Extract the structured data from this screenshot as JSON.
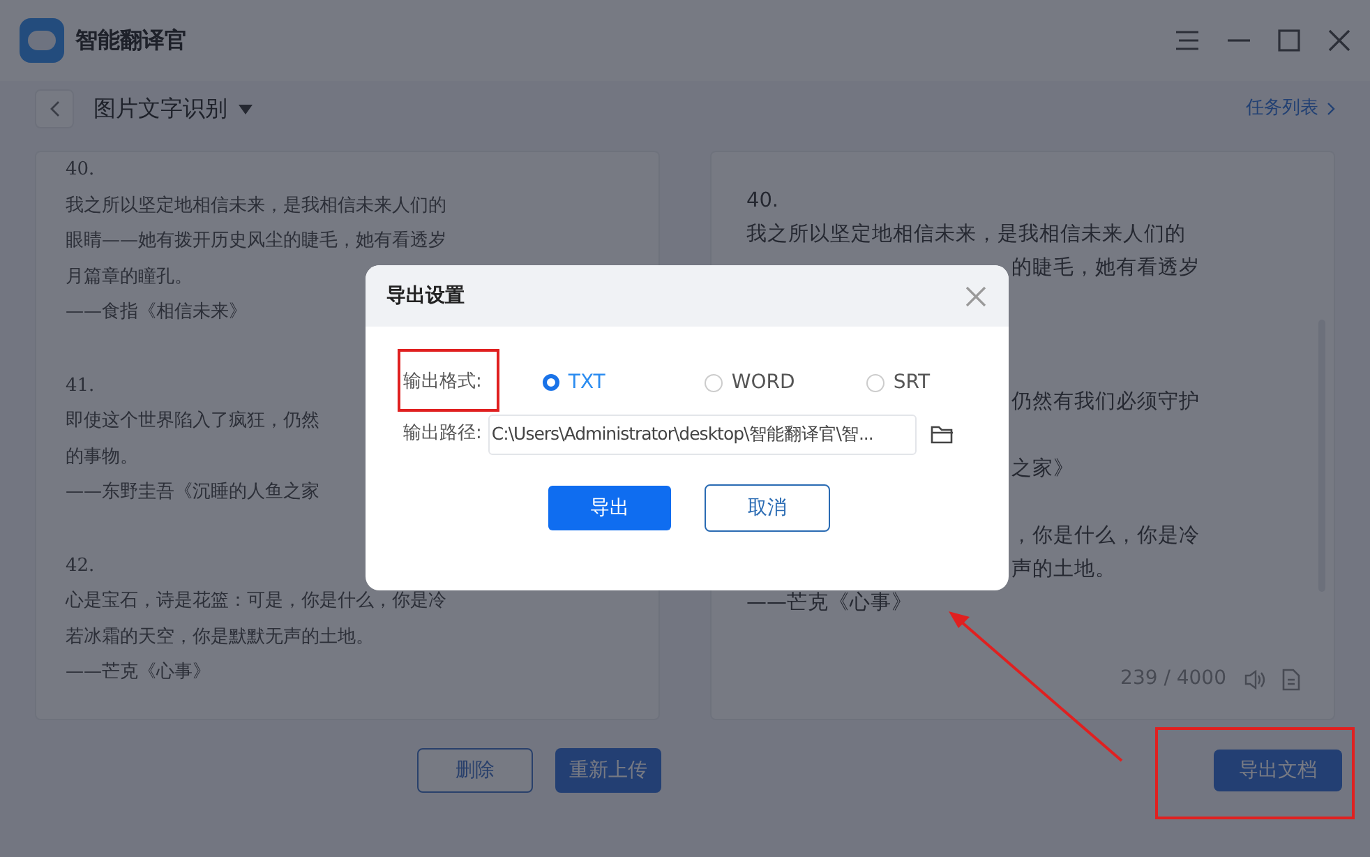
{
  "window": {
    "title": "智能翻译官"
  },
  "header": {
    "title": "图片文字识别",
    "link": "任务列表"
  },
  "source_lines": [
    {
      "kind": "text",
      "text": "40."
    },
    {
      "kind": "text",
      "text": "我之所以坚定地相信未来，是我相信未来人们的"
    },
    {
      "kind": "text",
      "text": "眼睛——她有拨开历史风尘的睫毛，她有看透岁"
    },
    {
      "kind": "text",
      "text": "月篇章的瞳孔。"
    },
    {
      "kind": "text",
      "text": "——食指《相信未来》"
    },
    {
      "kind": "gap"
    },
    {
      "kind": "text",
      "text": "41."
    },
    {
      "kind": "text",
      "text": "即使这个世界陷入了疯狂，仍然"
    },
    {
      "kind": "text",
      "text": "的事物。"
    },
    {
      "kind": "text",
      "text": "——东野圭吾《沉睡的人鱼之家"
    },
    {
      "kind": "gap"
    },
    {
      "kind": "text",
      "text": "42."
    },
    {
      "kind": "text",
      "text": "心是宝石，诗是花篮：可是，你是什么，你是冷"
    },
    {
      "kind": "text",
      "text": "若冰霜的天空，你是默默无声的土地。"
    },
    {
      "kind": "text",
      "text": "——芒克《心事》"
    }
  ],
  "result_lines": [
    {
      "kind": "full",
      "text": "40."
    },
    {
      "kind": "full",
      "text": "我之所以坚定地相信未来，是我相信未来人们的"
    },
    {
      "kind": "tail",
      "text": "的睫毛，她有看透岁"
    },
    {
      "kind": "gap"
    },
    {
      "kind": "gap"
    },
    {
      "kind": "gap"
    },
    {
      "kind": "tail",
      "text": "仍然有我们必须守护"
    },
    {
      "kind": "gap"
    },
    {
      "kind": "tail",
      "text": "之家》"
    },
    {
      "kind": "gap"
    },
    {
      "kind": "tail",
      "text": "，你是什么，你是冷"
    },
    {
      "kind": "tail",
      "text": "声的土地。"
    },
    {
      "kind": "full",
      "text": "——芒克《心事》"
    }
  ],
  "counter": "239 / 4000",
  "buttons": {
    "delete": "删除",
    "reupload": "重新上传",
    "export_doc": "导出文档"
  },
  "dialog": {
    "title": "导出设置",
    "format_label": "输出格式:",
    "formats": [
      {
        "label": "TXT",
        "selected": true
      },
      {
        "label": "WORD",
        "selected": false
      },
      {
        "label": "SRT",
        "selected": false
      }
    ],
    "path_label": "输出路径:",
    "path": "C:\\Users\\Administrator\\desktop\\智能翻译官\\智...",
    "confirm": "导出",
    "cancel": "取消"
  }
}
